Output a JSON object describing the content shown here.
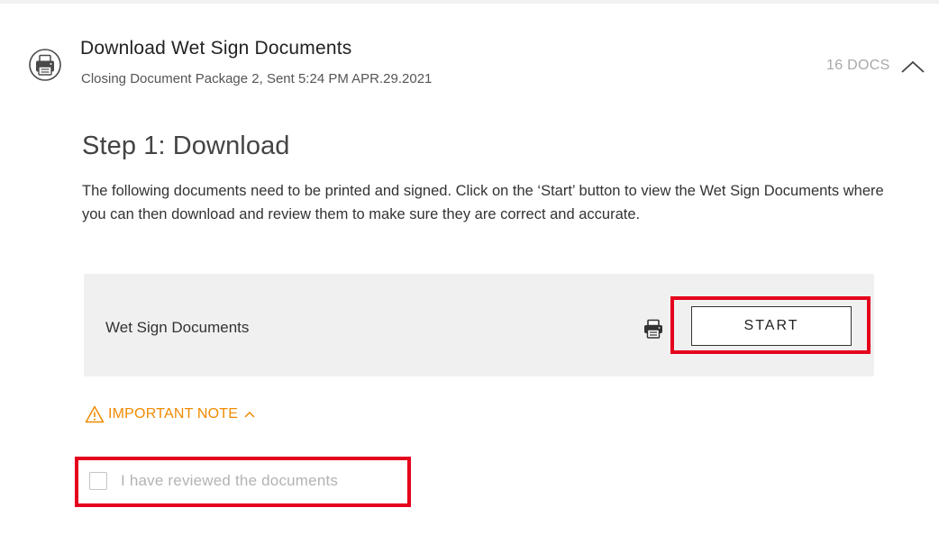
{
  "section": {
    "icon": "printer-icon",
    "title": "Download Wet Sign Documents",
    "subtitle": "Closing Document Package 2, Sent 5:24 PM APR.29.2021",
    "doc_count": "16 DOCS",
    "toggle_icon": "chevron-up-icon"
  },
  "step": {
    "title": "Step 1: Download",
    "description": "The following documents need to be printed and signed. Click on the ‘Start’ button to view the Wet Sign Documents where you can then download and review them to make sure they are correct and accurate."
  },
  "doc_panel": {
    "label": "Wet Sign Documents",
    "icon": "printer-icon",
    "start_label": "START"
  },
  "important_note": {
    "icon": "warning-icon",
    "label": "IMPORTANT NOTE",
    "toggle_icon": "chevron-up-icon"
  },
  "review": {
    "checked": false,
    "label": "I have reviewed the documents"
  },
  "colors": {
    "highlight": "#e5001c",
    "note_accent": "#f08a00",
    "panel_background": "#f0f0f0",
    "muted_text": "#b3b3b3"
  }
}
